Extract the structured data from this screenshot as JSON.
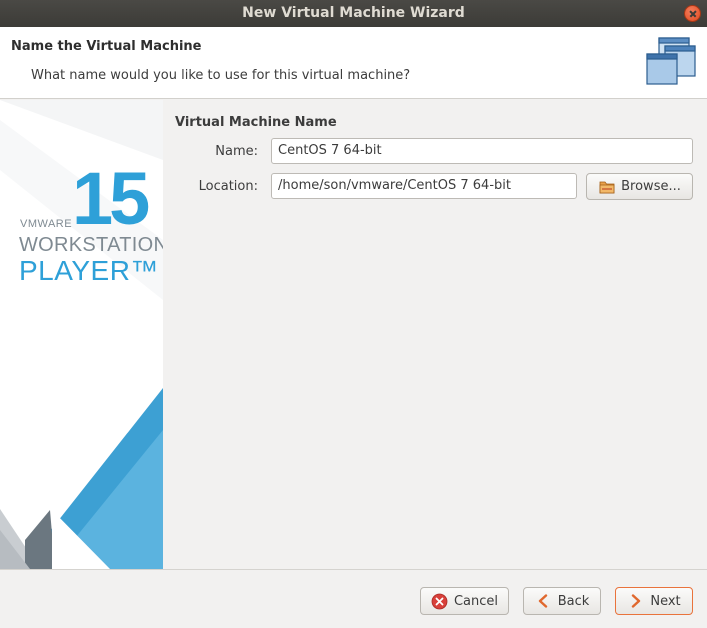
{
  "window": {
    "title": "New Virtual Machine Wizard"
  },
  "header": {
    "title": "Name the Virtual Machine",
    "subtitle": "What name would you like to use for this virtual machine?",
    "icon": "stacked-windows-icon"
  },
  "branding": {
    "version": "15",
    "vendor": "VMWARE",
    "product_line": "WORKSTATION",
    "product": "PLAYER™",
    "accent_color": "#2ea0d8"
  },
  "form": {
    "section_title": "Virtual Machine Name",
    "name_label": "Name:",
    "name_value": "CentOS 7 64-bit",
    "location_label": "Location:",
    "location_value": "/home/son/vmware/CentOS 7 64-bit",
    "browse_label": "Browse..."
  },
  "buttons": {
    "cancel": "Cancel",
    "back": "Back",
    "next": "Next"
  },
  "icons": {
    "cancel": "cancel-circle-icon",
    "back": "chevron-left-icon",
    "next": "chevron-right-icon",
    "browse": "folder-icon"
  }
}
